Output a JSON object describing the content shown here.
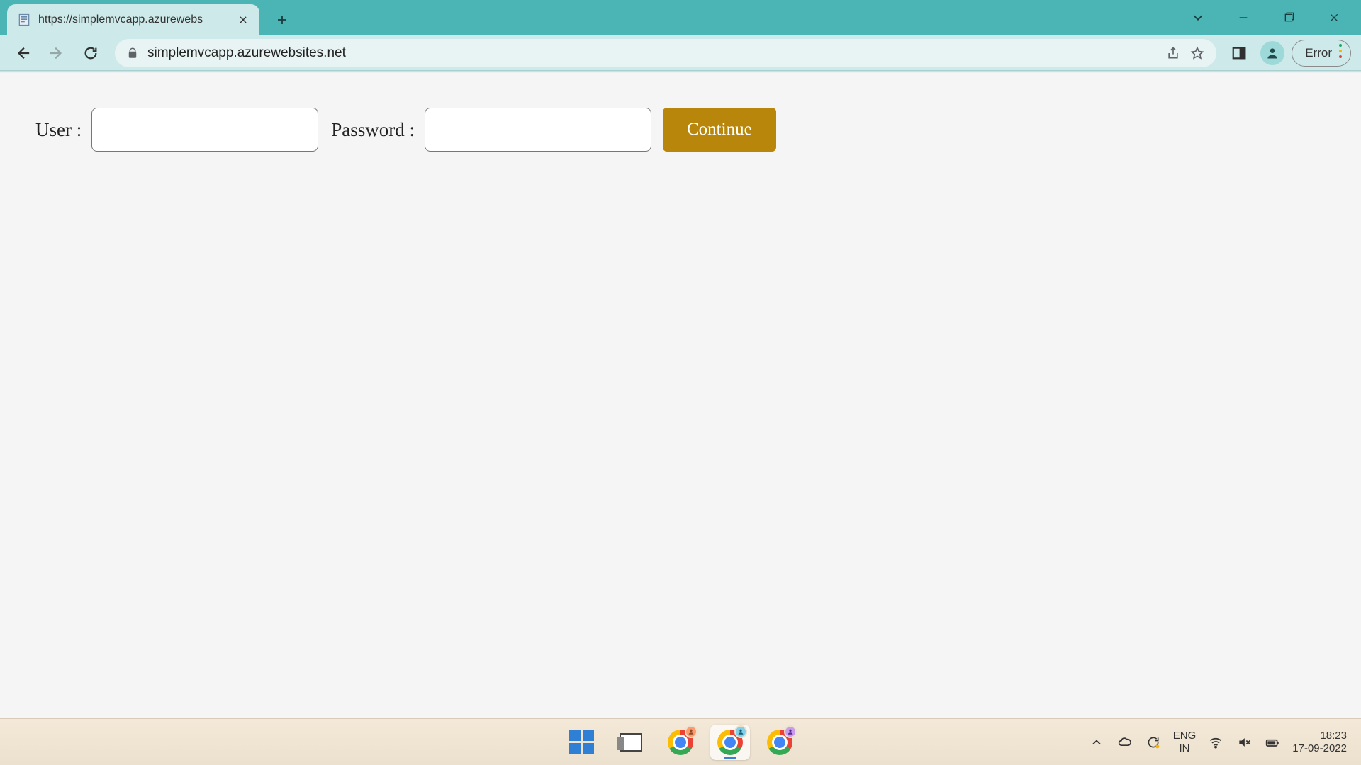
{
  "browser": {
    "tab_title": "https://simplemvcapp.azurewebs",
    "url_display": "simplemvcapp.azurewebsites.net",
    "error_label": "Error"
  },
  "page": {
    "user_label": "User :",
    "password_label": "Password :",
    "continue_label": "Continue",
    "user_value": "",
    "password_value": ""
  },
  "taskbar": {
    "lang_top": "ENG",
    "lang_bottom": "IN",
    "time": "18:23",
    "date": "17-09-2022"
  }
}
